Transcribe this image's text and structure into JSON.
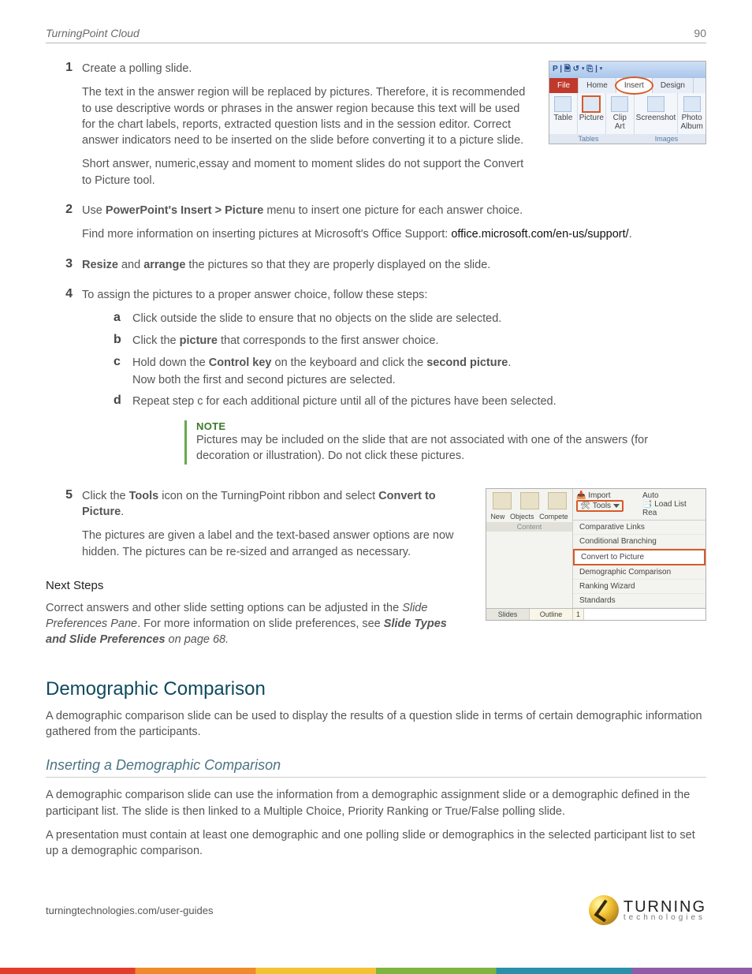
{
  "header": {
    "title": "TurningPoint Cloud",
    "page": "90"
  },
  "steps": {
    "s1": {
      "num": "1",
      "l1": "Create a polling slide.",
      "l2": "The text in the answer region will be replaced by pictures. Therefore, it is recommended to use descriptive words or phrases in the answer region because this text will be used for the chart labels, reports, extracted question lists and in the session editor. Correct answer indicators need to be inserted on the slide before converting it to a picture slide.",
      "l3": "Short answer, numeric,essay and moment to moment slides do not support the Convert to Picture tool."
    },
    "s2": {
      "num": "2",
      "pre": "Use ",
      "bold": "PowerPoint's Insert > Picture",
      "post": " menu to insert one picture for each answer choice.",
      "l2a": "Find more information on inserting pictures at Microsoft's Office Support: ",
      "link": "office.microsoft.com/en-us/support/",
      "l2b": "."
    },
    "s3": {
      "num": "3",
      "b1": "Resize",
      "mid": " and ",
      "b2": "arrange",
      "post": " the pictures so that they are properly displayed on the slide."
    },
    "s4": {
      "num": "4",
      "l1": "To assign the pictures to a proper answer choice, follow these steps:",
      "a": {
        "n": "a",
        "t": "Click outside the slide to ensure that no objects on the slide are selected."
      },
      "b": {
        "n": "b",
        "pre": "Click the ",
        "bold": "picture",
        "post": " that corresponds to the first answer choice."
      },
      "c": {
        "n": "c",
        "pre": "Hold down the ",
        "b1": "Control key",
        "mid": " on the keyboard and click the ",
        "b2": "second picture",
        "post": ".",
        "l2": "Now both the first and second pictures are selected."
      },
      "d": {
        "n": "d",
        "t": "Repeat step c for each additional picture until all of the pictures have been selected."
      }
    },
    "note": {
      "title": "NOTE",
      "body": "Pictures may be included on the slide that are not associated with one of the answers (for decoration or illustration). Do not click these pictures."
    },
    "s5": {
      "num": "5",
      "pre": "Click the ",
      "b1": "Tools",
      "mid": " icon on the TurningPoint ribbon and select ",
      "b2": "Convert to Picture",
      "post": ".",
      "l2": "The pictures are given a label and the text-based answer options are now hidden. The pictures can be re-sized and arranged as necessary."
    }
  },
  "fig1": {
    "qat": "P",
    "file": "File",
    "home": "Home",
    "insert": "Insert",
    "design": "Design",
    "g": {
      "table": "Table",
      "picture": "Picture",
      "clipart": "Clip Art",
      "screenshot": "Screenshot",
      "album": "Photo Album"
    },
    "bar": {
      "tables": "Tables",
      "images": "Images"
    }
  },
  "fig2": {
    "new": "New",
    "objects": "Objects",
    "compete": "Compete",
    "content": "Content",
    "import": "Import",
    "tools": "Tools",
    "auto": "Auto",
    "loadlist": "Load List",
    "rea": "Rea",
    "m1": "Comparative Links",
    "m2": "Conditional Branching",
    "m3": "Convert to Picture",
    "m4": "Demographic Comparison",
    "m5": "Ranking Wizard",
    "m6": "Standards",
    "slides": "Slides",
    "outline": "Outline",
    "one": "1"
  },
  "nextsteps": {
    "h": "Next Steps",
    "pre": "Correct answers and other slide setting options can be adjusted in the ",
    "i1": "Slide Preferences Pane",
    "mid": ". For more information on slide preferences, see ",
    "bi": "Slide Types and Slide Preferences",
    "post": " on page 68."
  },
  "demo": {
    "h": "Demographic Comparison",
    "p": "A demographic comparison slide can be used to display the results of a question slide in terms of certain demographic information gathered from the participants."
  },
  "insert": {
    "h": "Inserting a Demographic Comparison",
    "p1": "A demographic comparison slide can use the information from a demographic assignment slide or a demographic defined in the participant list. The slide is then linked to a Multiple Choice, Priority Ranking or True/False polling slide.",
    "p2": "A presentation must contain at least one demographic and one polling slide or demographics in the selected participant list to set up a demographic comparison."
  },
  "footer": {
    "url": "turningtechnologies.com/user-guides",
    "brand1": "TURNING",
    "brand2": "technologies"
  }
}
